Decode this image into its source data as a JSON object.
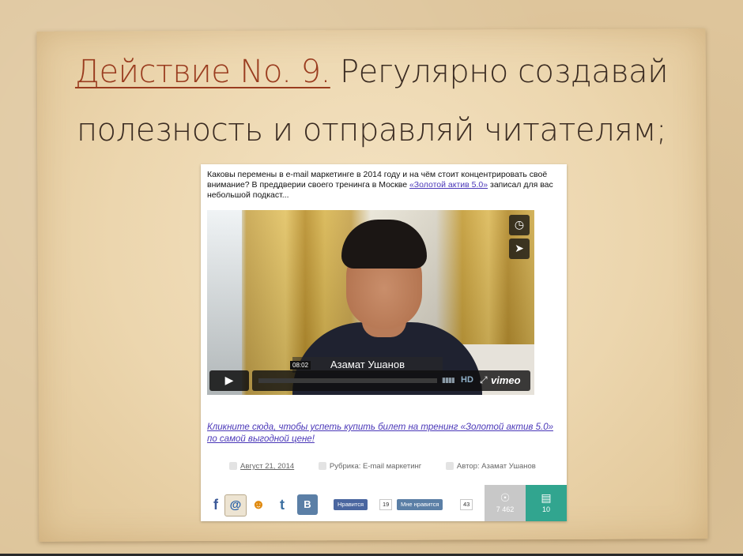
{
  "slide": {
    "title_accent": "Действие No. 9.",
    "title_rest": "Регулярно создавай",
    "title_line2": "полезность и отправляй читателям;"
  },
  "post": {
    "intro_text": "Каковы перемены в e-mail маркетинге в 2014 году и на чём стоит концентрировать своё внимание? В преддверии своего тренинга в Москве ",
    "intro_link": "«Золотой актив 5.0»",
    "intro_tail": " записал для вас небольшой подкаст...",
    "video": {
      "caption": "Азамат Ушанов",
      "time": "08:02",
      "hd_label": "HD",
      "vimeo_label": "vimeo",
      "clock_icon": "clock-icon",
      "share_icon": "send-icon",
      "play_icon": "play-icon"
    },
    "cta_link": "Кликните сюда, чтобы успеть купить билет на тренинг «Золотой актив 5.0» по самой выгодной цене!",
    "meta": {
      "date": "Август 21, 2014",
      "category": "Рубрика: E-mail маркетинг",
      "author": "Автор: Азамат Ушанов"
    },
    "social": {
      "fb_like_label": "Нравится",
      "fb_like_count": "19",
      "vk_like_label": "Мне нравится",
      "vk_like_count": "43",
      "views": "7 462",
      "comments": "10",
      "vk_letter": "В",
      "accent_color": "#31a58f"
    }
  }
}
